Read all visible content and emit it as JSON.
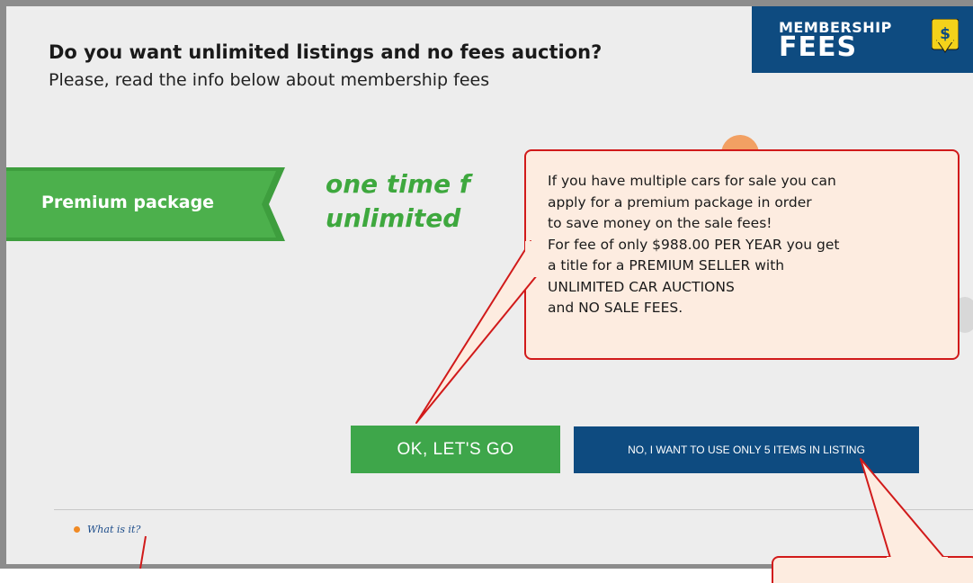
{
  "dialog": {
    "title": "Do you want unlimited listings and no fees auction?",
    "subtitle": "Please, read the info below about membership fees"
  },
  "badge": {
    "line1": "MEMBERSHIP",
    "line2": "FEES",
    "icon_glyph": "$",
    "icon": "dollar-download-icon"
  },
  "package": {
    "ribbon_label": "Premium package",
    "headline_line1": "one time f",
    "headline_line2": "unlimited"
  },
  "buttons": {
    "ok_label": "OK, LET'S GO",
    "no_label": "NO, I WANT TO USE ONLY 5 ITEMS IN LISTING"
  },
  "footer": {
    "help_link": "What is it?"
  },
  "tooltip": {
    "lines": [
      "If you have multiple cars for sale you can",
      "apply for a premium package in order",
      "to save money on the sale fees!",
      "For fee of only $988.00 PER YEAR you get",
      "a title for a PREMIUM SELLER with",
      "UNLIMITED CAR AUCTIONS",
      "and NO SALE FEES."
    ]
  },
  "colors": {
    "green": "#3ea64a",
    "navy": "#0e4b80",
    "callout_border": "#d11a1a",
    "callout_fill": "#fdece0",
    "bullet": "#f08a24"
  }
}
